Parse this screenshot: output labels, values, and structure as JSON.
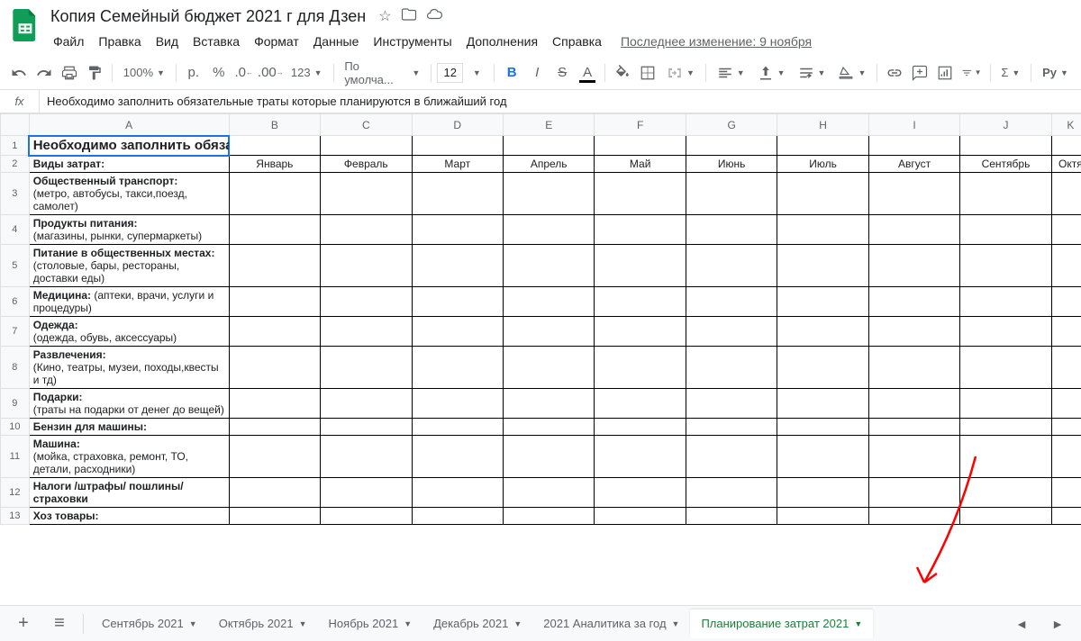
{
  "header": {
    "title": "Копия Семейный бюджет 2021 г  для Дзен",
    "last_edit": "Последнее изменение: 9 ноября"
  },
  "menus": [
    "Файл",
    "Правка",
    "Вид",
    "Вставка",
    "Формат",
    "Данные",
    "Инструменты",
    "Дополнения",
    "Справка"
  ],
  "toolbar": {
    "zoom": "100%",
    "currency": "р.",
    "format_default": "По умолча...",
    "font_size": "12",
    "more_formats": "123"
  },
  "formula_bar": {
    "fx": "fx",
    "value": "Необходимо заполнить обязательные траты которые планируются в ближайший год"
  },
  "columns": [
    "A",
    "B",
    "C",
    "D",
    "E",
    "F",
    "G",
    "H",
    "I",
    "J",
    "K"
  ],
  "months": [
    "Январь",
    "Февраль",
    "Март",
    "Апрель",
    "Май",
    "Июнь",
    "Июль",
    "Август",
    "Сентябрь",
    "Октя"
  ],
  "row1_text_a": "Необходимо заполнить об",
  "row1_text_rest": "язательные траты которые планируются в ближайший год",
  "row2_header": "Виды затрат:",
  "categories": [
    {
      "num": "3",
      "bold": "Общественный транспорт:",
      "sub": "(метро, автобусы, такси,поезд, самолет)"
    },
    {
      "num": "4",
      "bold": "Продукты питания:",
      "sub": "(магазины, рынки, супермаркеты)"
    },
    {
      "num": "5",
      "bold": "Питание в общественных местах:",
      "sub": "(столовые, бары, рестораны, доставки еды)"
    },
    {
      "num": "6",
      "bold": "Медицина: ",
      "bold2": "",
      "sub_inline": "(аптеки, врачи, услуги и процедуры)"
    },
    {
      "num": "7",
      "bold": "Одежда:",
      "sub": "(одежда, обувь, аксессуары)"
    },
    {
      "num": "8",
      "bold": "Развлечения:",
      "sub": "(Кино, театры, музеи, походы,квесты и тд)"
    },
    {
      "num": "9",
      "bold": "Подарки:",
      "sub": "(траты на подарки от денег до вещей)"
    },
    {
      "num": "10",
      "bold": "Бензин для машины:",
      "sub": ""
    },
    {
      "num": "11",
      "bold": "Машина:",
      "sub": "(мойка, страховка, ремонт, ТО, детали, расходники)"
    },
    {
      "num": "12",
      "bold": "Налоги /штрафы/ пошлины/ страховки",
      "sub": ""
    },
    {
      "num": "13",
      "bold": "Хоз товары:",
      "sub": ""
    }
  ],
  "tabs": [
    {
      "label": "Сентябрь 2021",
      "active": false
    },
    {
      "label": "Октябрь 2021",
      "active": false
    },
    {
      "label": "Ноябрь 2021",
      "active": false
    },
    {
      "label": "Декабрь 2021",
      "active": false
    },
    {
      "label": "2021 Аналитика за год",
      "active": false
    },
    {
      "label": "Планирование затрат 2021",
      "active": true
    }
  ]
}
